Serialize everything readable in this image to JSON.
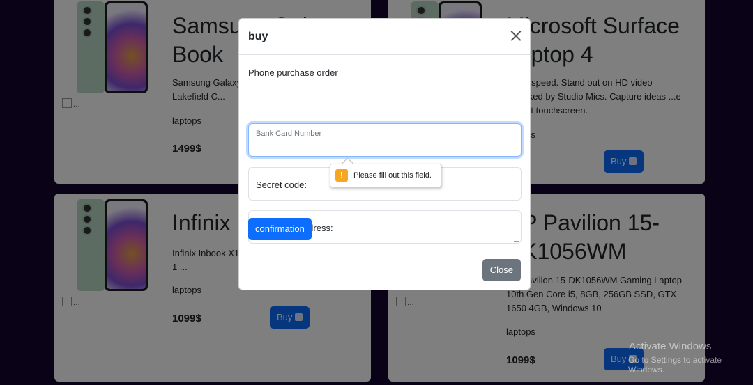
{
  "cards": [
    {
      "title": "Samsung Galaxy Book",
      "description": "Samsung Galaxy Book ... Intel Lakefield C...",
      "category": "laptops",
      "price": "1499$",
      "buy_label": ""
    },
    {
      "title": "Microsoft Surface Laptop 4",
      "description": "...and speed. Stand out on HD video ...packed by Studio Mics. Capture ideas ...e vibrant touchscreen.",
      "category": "laptops",
      "price": "...$",
      "buy_label": "Buy"
    },
    {
      "title": "Infinix",
      "description": "Infinix Inbook X1... Win10 Grey – 1 ...",
      "category": "laptops",
      "price": "1099$",
      "buy_label": "Buy"
    },
    {
      "title": "HP Pavilion 15-DK1056WM",
      "description": "HP Pavilion 15-DK1056WM Gaming Laptop 10th Gen Core i5, 8GB, 256GB SSD, GTX 1650 4GB, Windows 10",
      "category": "laptops",
      "price": "1099$",
      "buy_label": "Buy"
    }
  ],
  "broken_image_alt": "...",
  "modal": {
    "title": "buy",
    "form_caption": "Phone purchase order",
    "card_number_placeholder": "Bank Card Number",
    "secret_code_label": "Secret code:",
    "address_label": "Receiving address:",
    "validation_message": "Please fill out this field.",
    "confirm_label": "confirmation",
    "close_label": "Close"
  },
  "watermark": {
    "line1": "Activate Windows",
    "line2": "Go to Settings to activate Windows."
  },
  "colors": {
    "page_background": "#15052e",
    "primary": "#0d6efd",
    "secondary": "#6c757d",
    "warning": "#f5a623"
  }
}
